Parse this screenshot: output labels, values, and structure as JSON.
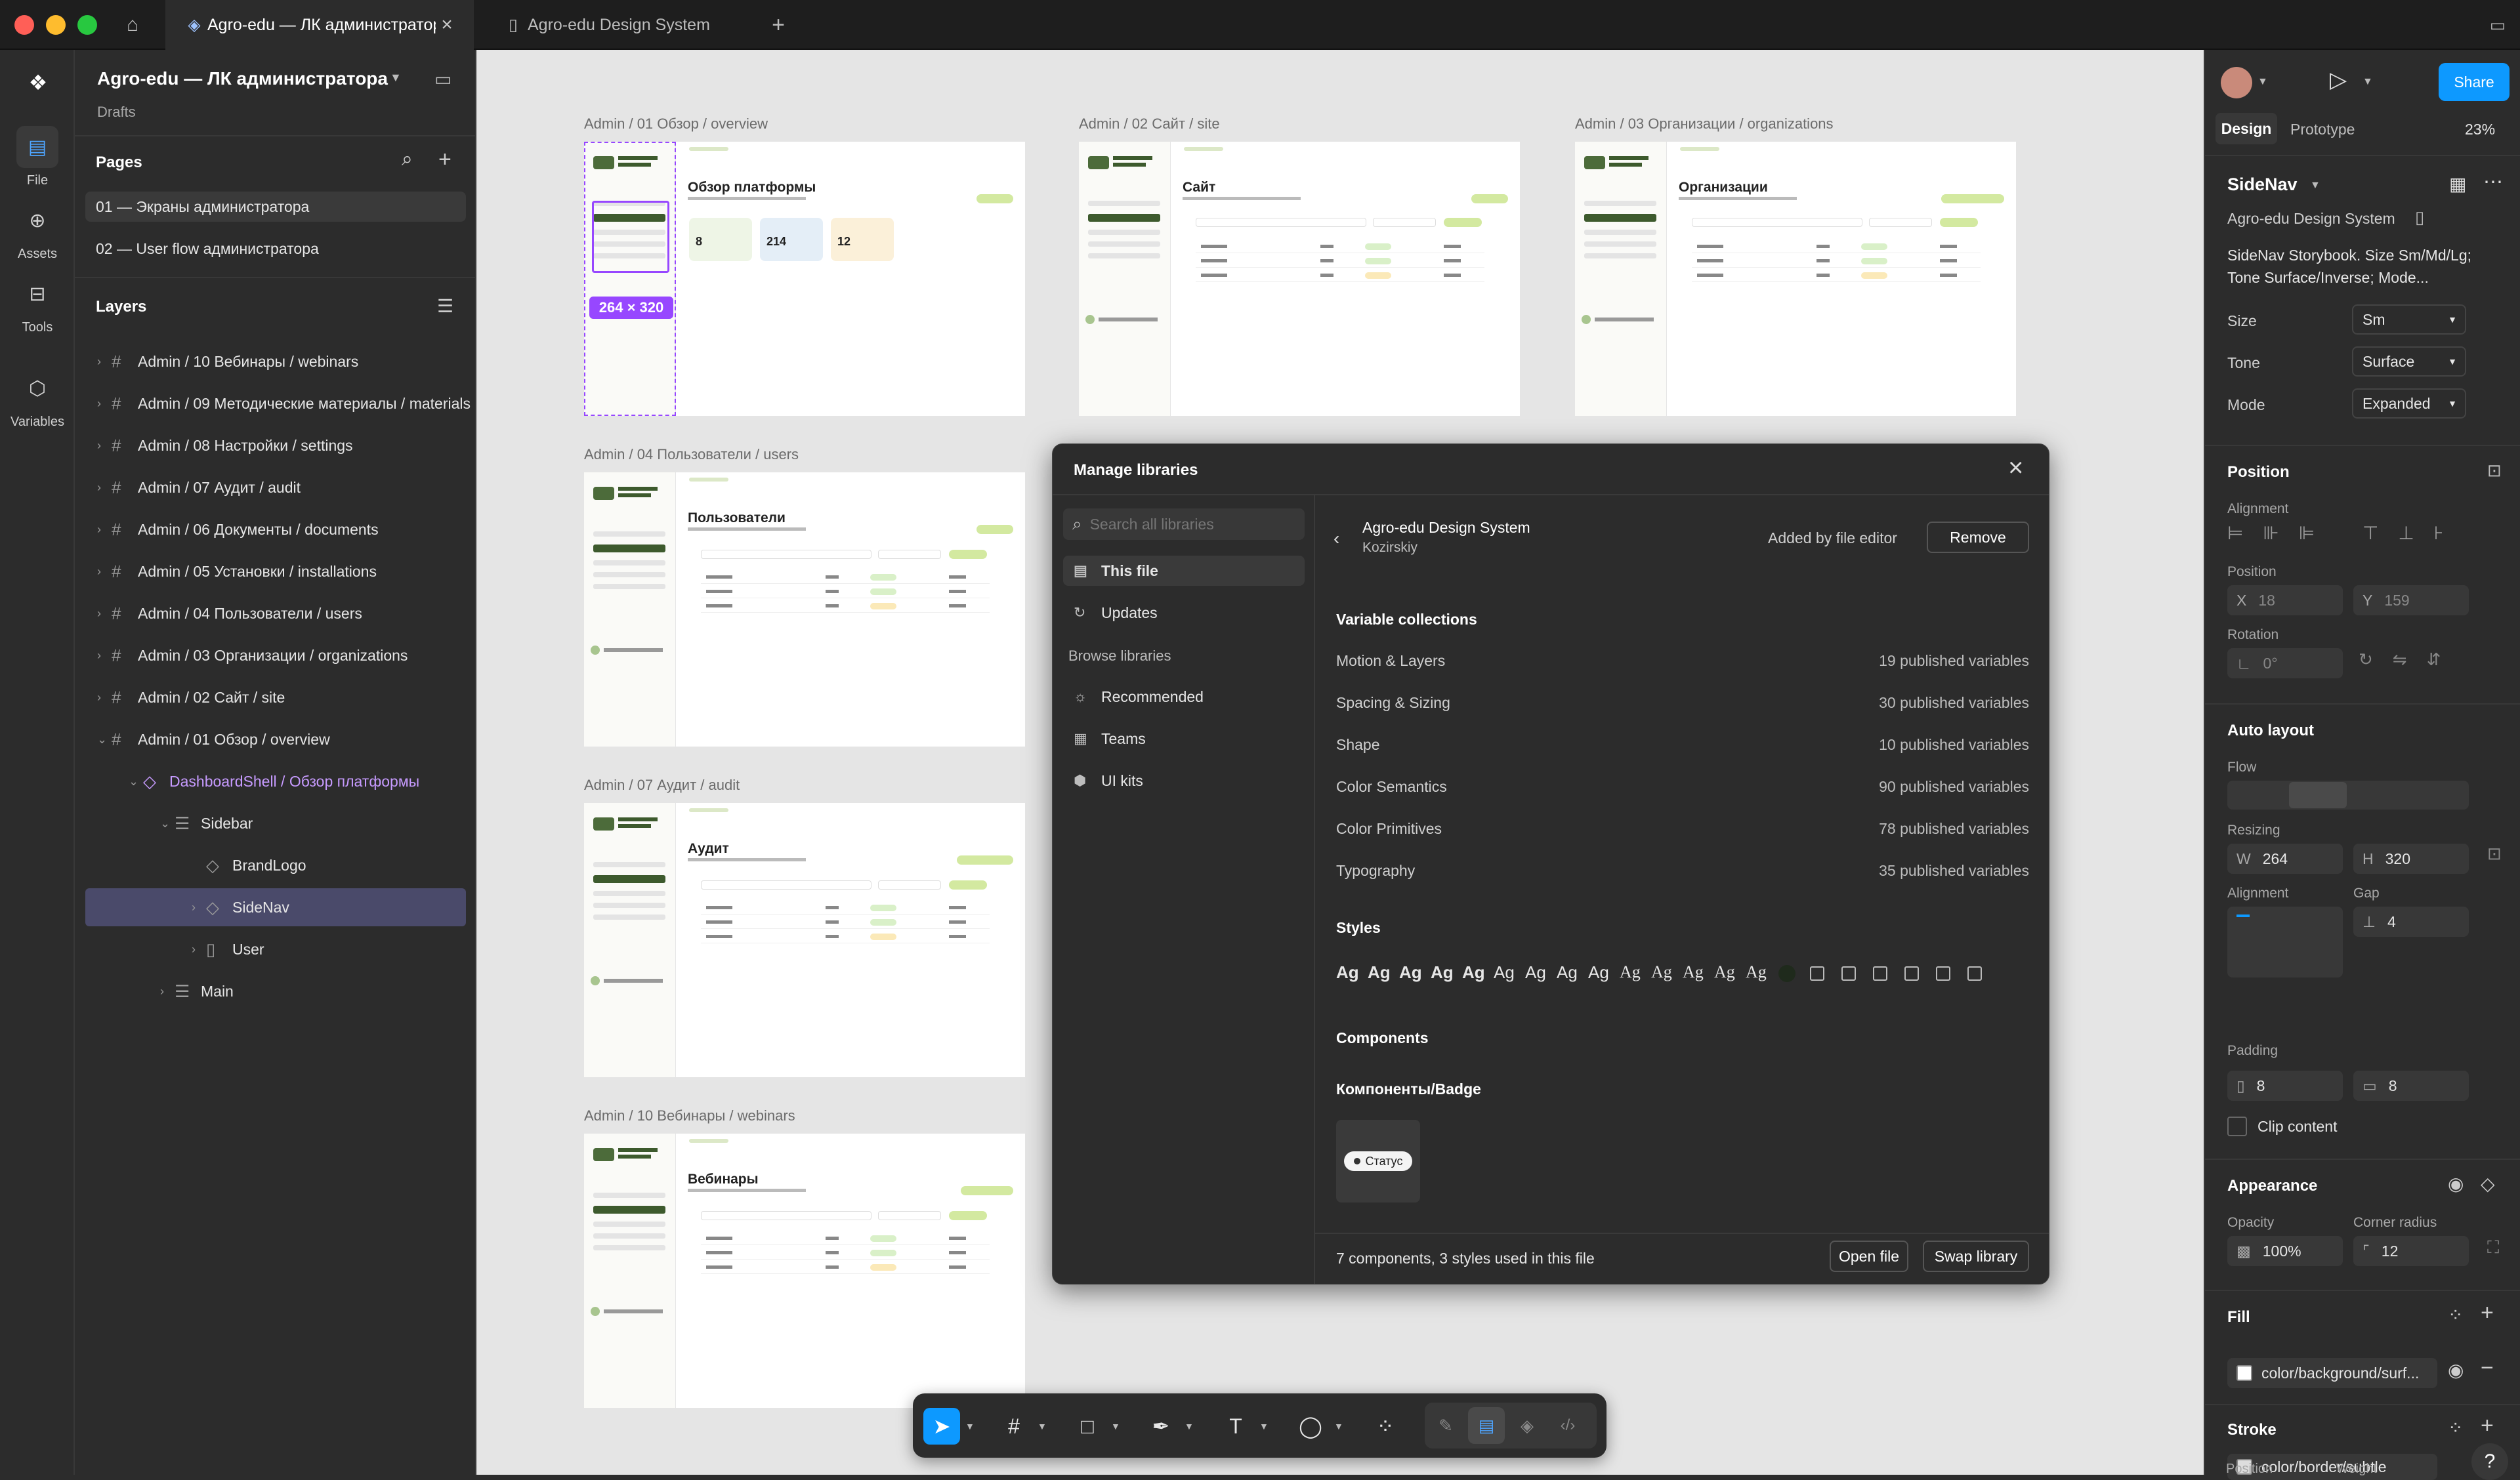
{
  "titlebar": {
    "tabs": [
      {
        "label": "Agro-edu — ЛК администратор..."
      },
      {
        "label": "Agro-edu Design System"
      }
    ]
  },
  "rail": {
    "items": [
      {
        "label": "File",
        "icon": "file-icon"
      },
      {
        "label": "Assets",
        "icon": "assets-icon"
      },
      {
        "label": "Tools",
        "icon": "tools-icon"
      },
      {
        "label": "Variables",
        "icon": "variables-icon"
      }
    ]
  },
  "file": {
    "title": "Agro-edu — ЛК администратора",
    "location": "Drafts"
  },
  "pages": {
    "heading": "Pages",
    "items": [
      {
        "label": "01 — Экраны администратора"
      },
      {
        "label": "02 — User flow администратора"
      }
    ]
  },
  "layers": {
    "heading": "Layers",
    "items": [
      {
        "label": "Admin / 10 Вебинары / webinars"
      },
      {
        "label": "Admin / 09 Методические материалы / materials"
      },
      {
        "label": "Admin / 08 Настройки / settings"
      },
      {
        "label": "Admin / 07 Аудит / audit"
      },
      {
        "label": "Admin / 06 Документы / documents"
      },
      {
        "label": "Admin / 05 Установки / installations"
      },
      {
        "label": "Admin / 04 Пользователи / users"
      },
      {
        "label": "Admin / 03 Организации / organizations"
      },
      {
        "label": "Admin / 02 Сайт / site"
      },
      {
        "label": "Admin / 01 Обзор / overview"
      },
      {
        "label": "DashboardShell / Обзор платформы"
      },
      {
        "label": "Sidebar"
      },
      {
        "label": "BrandLogo"
      },
      {
        "label": "SideNav"
      },
      {
        "label": "User"
      },
      {
        "label": "Main"
      }
    ]
  },
  "canvas": {
    "frames": [
      {
        "label": "Admin / 01 Обзор / overview",
        "title": "Обзор платформы"
      },
      {
        "label": "Admin / 02 Сайт / site",
        "title": "Сайт"
      },
      {
        "label": "Admin / 03 Организации / organizations",
        "title": "Организации"
      },
      {
        "label": "Admin / 04 Пользователи / users",
        "title": "Пользователи"
      },
      {
        "label": "Admin / 07 Аудит / audit",
        "title": "Аудит"
      },
      {
        "label": "Admin / 10 Вебинары / webinars",
        "title": "Вебинары"
      }
    ],
    "stats": [
      "8",
      "214",
      "12"
    ],
    "selection_size": "264 × 320"
  },
  "modal": {
    "title": "Manage libraries",
    "search_placeholder": "Search all libraries",
    "nav": [
      {
        "label": "This file"
      },
      {
        "label": "Updates"
      }
    ],
    "browse_heading": "Browse libraries",
    "browse": [
      {
        "label": "Recommended"
      },
      {
        "label": "Teams"
      },
      {
        "label": "UI kits"
      }
    ],
    "library_name": "Agro-edu Design System",
    "library_author": "Kozirskiy",
    "added_by": "Added by file editor",
    "remove_label": "Remove",
    "var_heading": "Variable collections",
    "collections": [
      {
        "name": "Motion & Layers",
        "count": "19 published variables"
      },
      {
        "name": "Spacing & Sizing",
        "count": "30 published variables"
      },
      {
        "name": "Shape",
        "count": "10 published variables"
      },
      {
        "name": "Color Semantics",
        "count": "90 published variables"
      },
      {
        "name": "Color Primitives",
        "count": "78 published variables"
      },
      {
        "name": "Typography",
        "count": "35 published variables"
      }
    ],
    "styles_heading": "Styles",
    "style_sample": "Ag",
    "components_heading": "Components",
    "component_group": "Компоненты/Badge",
    "badge_label": "Статус",
    "footer_text": "7 components, 3 styles used in this file",
    "open_file": "Open file",
    "swap_library": "Swap library"
  },
  "right": {
    "tabs": [
      "Design",
      "Prototype"
    ],
    "zoom": "23%",
    "share": "Share",
    "component_name": "SideNav",
    "library": "Agro-edu Design System",
    "description": "SideNav Storybook. Size Sm/Md/Lg; Tone Surface/Inverse; Mode...",
    "props": [
      {
        "label": "Size",
        "value": "Sm"
      },
      {
        "label": "Tone",
        "value": "Surface"
      },
      {
        "label": "Mode",
        "value": "Expanded"
      }
    ],
    "position_heading": "Position",
    "alignment_label": "Alignment",
    "position_label": "Position",
    "x_label": "X",
    "x": "18",
    "y_label": "Y",
    "y": "159",
    "rotation_label": "Rotation",
    "rotation": "0°",
    "autolayout_heading": "Auto layout",
    "flow_label": "Flow",
    "resizing_label": "Resizing",
    "w_label": "W",
    "w": "264",
    "h_label": "H",
    "h": "320",
    "align_label": "Alignment",
    "gap_label": "Gap",
    "gap": "4",
    "padding_label": "Padding",
    "padding_h": "8",
    "padding_v": "8",
    "clip_label": "Clip content",
    "appearance_heading": "Appearance",
    "opacity_label": "Opacity",
    "opacity": "100%",
    "radius_label": "Corner radius",
    "radius": "12",
    "fill_heading": "Fill",
    "fill_value": "color/background/surf...",
    "stroke_heading": "Stroke",
    "stroke_value": "color/border/subtle",
    "stroke_position_label": "Position",
    "stroke_weight_label": "Weight"
  },
  "colors": {
    "accent": "#0d99ff",
    "selection": "#9747ff",
    "component": "#c79bff"
  }
}
